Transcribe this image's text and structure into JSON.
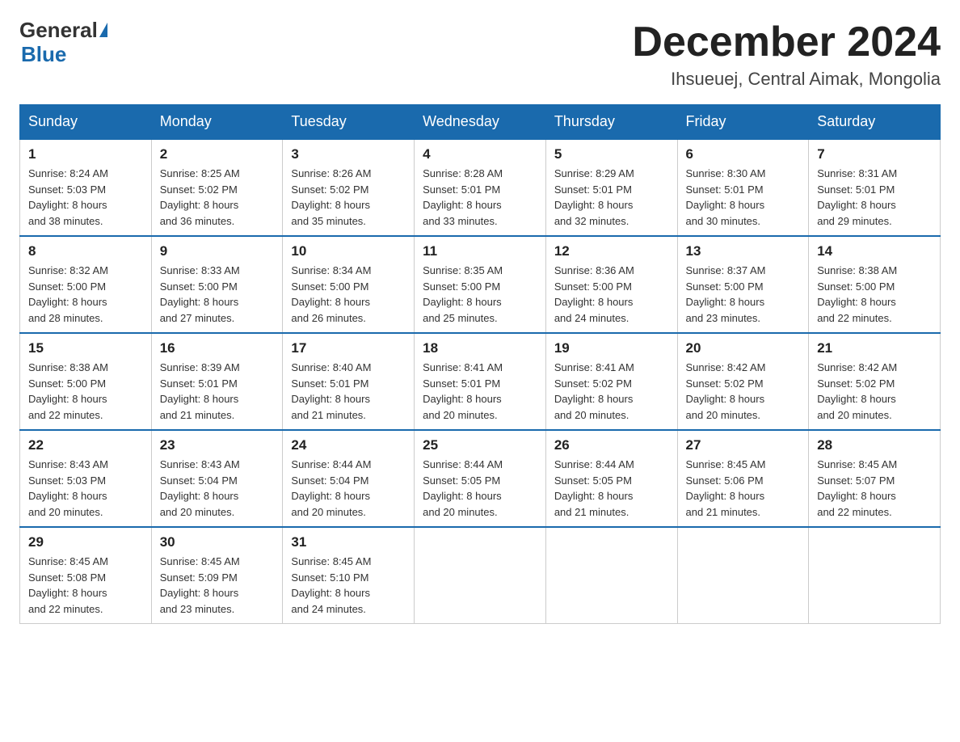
{
  "logo": {
    "general": "General",
    "blue": "Blue"
  },
  "title": "December 2024",
  "location": "Ihsueuej, Central Aimak, Mongolia",
  "weekdays": [
    "Sunday",
    "Monday",
    "Tuesday",
    "Wednesday",
    "Thursday",
    "Friday",
    "Saturday"
  ],
  "weeks": [
    [
      {
        "day": "1",
        "sunrise": "8:24 AM",
        "sunset": "5:03 PM",
        "daylight": "8 hours and 38 minutes."
      },
      {
        "day": "2",
        "sunrise": "8:25 AM",
        "sunset": "5:02 PM",
        "daylight": "8 hours and 36 minutes."
      },
      {
        "day": "3",
        "sunrise": "8:26 AM",
        "sunset": "5:02 PM",
        "daylight": "8 hours and 35 minutes."
      },
      {
        "day": "4",
        "sunrise": "8:28 AM",
        "sunset": "5:01 PM",
        "daylight": "8 hours and 33 minutes."
      },
      {
        "day": "5",
        "sunrise": "8:29 AM",
        "sunset": "5:01 PM",
        "daylight": "8 hours and 32 minutes."
      },
      {
        "day": "6",
        "sunrise": "8:30 AM",
        "sunset": "5:01 PM",
        "daylight": "8 hours and 30 minutes."
      },
      {
        "day": "7",
        "sunrise": "8:31 AM",
        "sunset": "5:01 PM",
        "daylight": "8 hours and 29 minutes."
      }
    ],
    [
      {
        "day": "8",
        "sunrise": "8:32 AM",
        "sunset": "5:00 PM",
        "daylight": "8 hours and 28 minutes."
      },
      {
        "day": "9",
        "sunrise": "8:33 AM",
        "sunset": "5:00 PM",
        "daylight": "8 hours and 27 minutes."
      },
      {
        "day": "10",
        "sunrise": "8:34 AM",
        "sunset": "5:00 PM",
        "daylight": "8 hours and 26 minutes."
      },
      {
        "day": "11",
        "sunrise": "8:35 AM",
        "sunset": "5:00 PM",
        "daylight": "8 hours and 25 minutes."
      },
      {
        "day": "12",
        "sunrise": "8:36 AM",
        "sunset": "5:00 PM",
        "daylight": "8 hours and 24 minutes."
      },
      {
        "day": "13",
        "sunrise": "8:37 AM",
        "sunset": "5:00 PM",
        "daylight": "8 hours and 23 minutes."
      },
      {
        "day": "14",
        "sunrise": "8:38 AM",
        "sunset": "5:00 PM",
        "daylight": "8 hours and 22 minutes."
      }
    ],
    [
      {
        "day": "15",
        "sunrise": "8:38 AM",
        "sunset": "5:00 PM",
        "daylight": "8 hours and 22 minutes."
      },
      {
        "day": "16",
        "sunrise": "8:39 AM",
        "sunset": "5:01 PM",
        "daylight": "8 hours and 21 minutes."
      },
      {
        "day": "17",
        "sunrise": "8:40 AM",
        "sunset": "5:01 PM",
        "daylight": "8 hours and 21 minutes."
      },
      {
        "day": "18",
        "sunrise": "8:41 AM",
        "sunset": "5:01 PM",
        "daylight": "8 hours and 20 minutes."
      },
      {
        "day": "19",
        "sunrise": "8:41 AM",
        "sunset": "5:02 PM",
        "daylight": "8 hours and 20 minutes."
      },
      {
        "day": "20",
        "sunrise": "8:42 AM",
        "sunset": "5:02 PM",
        "daylight": "8 hours and 20 minutes."
      },
      {
        "day": "21",
        "sunrise": "8:42 AM",
        "sunset": "5:02 PM",
        "daylight": "8 hours and 20 minutes."
      }
    ],
    [
      {
        "day": "22",
        "sunrise": "8:43 AM",
        "sunset": "5:03 PM",
        "daylight": "8 hours and 20 minutes."
      },
      {
        "day": "23",
        "sunrise": "8:43 AM",
        "sunset": "5:04 PM",
        "daylight": "8 hours and 20 minutes."
      },
      {
        "day": "24",
        "sunrise": "8:44 AM",
        "sunset": "5:04 PM",
        "daylight": "8 hours and 20 minutes."
      },
      {
        "day": "25",
        "sunrise": "8:44 AM",
        "sunset": "5:05 PM",
        "daylight": "8 hours and 20 minutes."
      },
      {
        "day": "26",
        "sunrise": "8:44 AM",
        "sunset": "5:05 PM",
        "daylight": "8 hours and 21 minutes."
      },
      {
        "day": "27",
        "sunrise": "8:45 AM",
        "sunset": "5:06 PM",
        "daylight": "8 hours and 21 minutes."
      },
      {
        "day": "28",
        "sunrise": "8:45 AM",
        "sunset": "5:07 PM",
        "daylight": "8 hours and 22 minutes."
      }
    ],
    [
      {
        "day": "29",
        "sunrise": "8:45 AM",
        "sunset": "5:08 PM",
        "daylight": "8 hours and 22 minutes."
      },
      {
        "day": "30",
        "sunrise": "8:45 AM",
        "sunset": "5:09 PM",
        "daylight": "8 hours and 23 minutes."
      },
      {
        "day": "31",
        "sunrise": "8:45 AM",
        "sunset": "5:10 PM",
        "daylight": "8 hours and 24 minutes."
      },
      null,
      null,
      null,
      null
    ]
  ],
  "labels": {
    "sunrise": "Sunrise:",
    "sunset": "Sunset:",
    "daylight": "Daylight:"
  }
}
